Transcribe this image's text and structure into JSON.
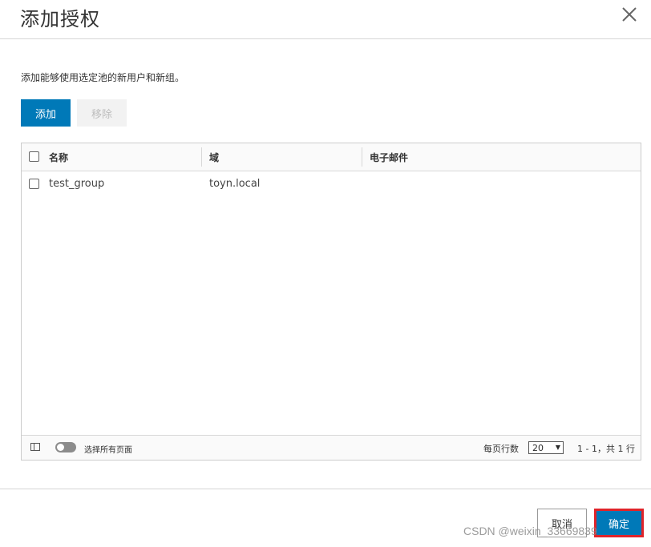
{
  "dialog": {
    "title": "添加授权",
    "description": "添加能够使用选定池的新用户和新组。"
  },
  "toolbar": {
    "add_label": "添加",
    "remove_label": "移除"
  },
  "table": {
    "columns": [
      "名称",
      "域",
      "电子邮件"
    ],
    "rows": [
      {
        "name": "test_group",
        "domain": "toyn.local",
        "email": ""
      }
    ]
  },
  "table_footer": {
    "select_all_pages_label": "选择所有页面",
    "rows_per_page_label": "每页行数",
    "rows_per_page_value": "20",
    "pagination_text": "1 - 1，共 1 行"
  },
  "footer": {
    "cancel_label": "取消",
    "ok_label": "确定"
  },
  "watermark": "CSDN @weixin_33669839",
  "colors": {
    "primary": "#0079b8",
    "highlight_border": "#e0242a"
  }
}
